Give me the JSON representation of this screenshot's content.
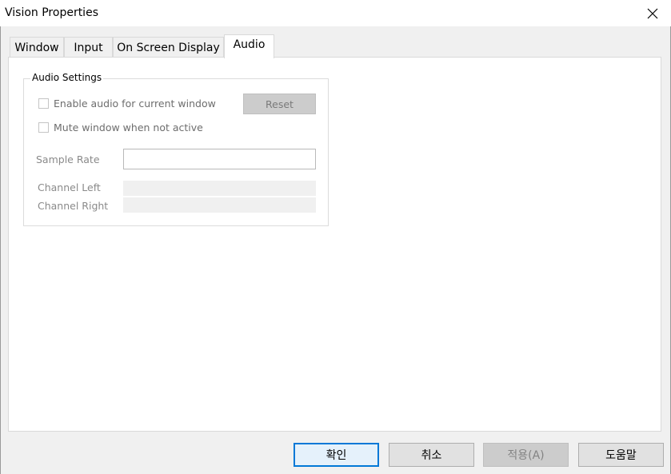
{
  "window": {
    "title": "Vision Properties",
    "close_glyph": "✕"
  },
  "tabs": [
    {
      "label": "Window",
      "active": false
    },
    {
      "label": "Input",
      "active": false
    },
    {
      "label": "On Screen Display",
      "active": false
    },
    {
      "label": "Audio",
      "active": true
    }
  ],
  "audio_settings": {
    "group_title": "Audio Settings",
    "enable_audio": {
      "label": "Enable audio for current window",
      "checked": false,
      "enabled": false
    },
    "mute_inactive": {
      "label": "Mute window when not active",
      "checked": false,
      "enabled": false
    },
    "reset_label": "Reset",
    "sample_rate": {
      "label": "Sample Rate",
      "value": ""
    },
    "channel_left": {
      "label": "Channel Left",
      "value": ""
    },
    "channel_right": {
      "label": "Channel Right",
      "value": ""
    }
  },
  "buttons": {
    "ok": "확인",
    "cancel": "취소",
    "apply": "적용(A)",
    "help": "도움말"
  },
  "colors": {
    "accent": "#0078d7",
    "disabled_text": "#838383"
  }
}
